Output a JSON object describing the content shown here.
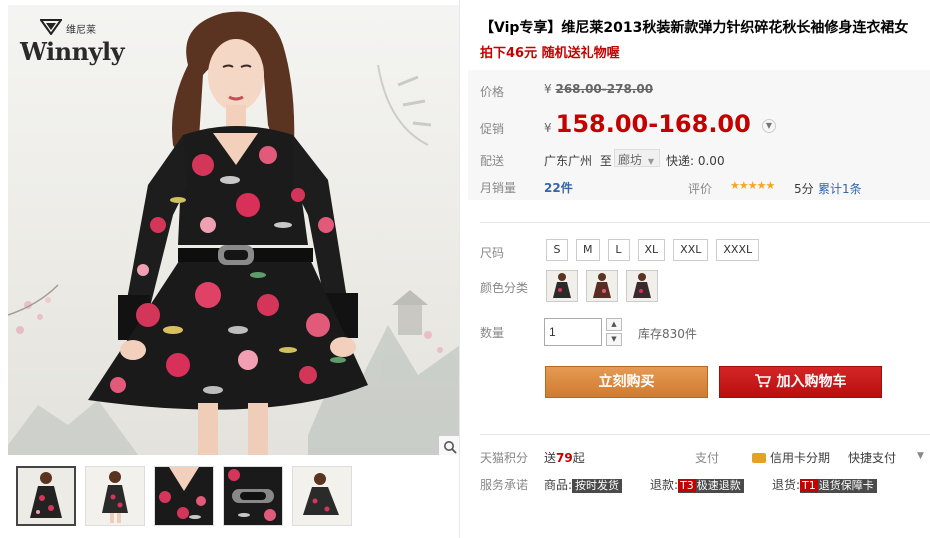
{
  "gallery": {
    "logo_cn": "维尼莱",
    "logo_en": "Winnyly",
    "thumbnails": [
      "thumb-1",
      "thumb-2",
      "thumb-3",
      "thumb-4",
      "thumb-5"
    ]
  },
  "product": {
    "title": "【Vip专享】维尼莱2013秋装新款弹力针织碎花秋长袖修身连衣裙女",
    "subtitle": "拍下46元 随机送礼物喔"
  },
  "price": {
    "label": "价格",
    "currency": "¥",
    "original": "268.00-278.00",
    "promo_label": "促销",
    "promo": "158.00-168.00"
  },
  "shipping": {
    "label": "配送",
    "from": "广东广州",
    "to_word": "至",
    "dest": "廊坊",
    "fee": "快递: 0.00"
  },
  "sales": {
    "label": "月销量",
    "count": "22件",
    "rating_label": "评价",
    "stars": "★★★★★",
    "score": "5分",
    "reviews": "累计1条"
  },
  "size": {
    "label": "尺码",
    "options": [
      "S",
      "M",
      "L",
      "XL",
      "XXL",
      "XXXL"
    ]
  },
  "color": {
    "label": "颜色分类",
    "options": [
      "color-1",
      "color-2",
      "color-3"
    ]
  },
  "quantity": {
    "label": "数量",
    "value": "1",
    "up": "▲",
    "down": "▼",
    "stock": "库存830件"
  },
  "actions": {
    "buy": "立刻购买",
    "cart": "加入购物车"
  },
  "points": {
    "label": "天猫积分",
    "prefix": "送",
    "value": "79",
    "suffix": "起"
  },
  "payment": {
    "label": "支付",
    "credit": "信用卡分期",
    "quick": "快捷支付"
  },
  "service": {
    "label": "服务承诺",
    "goods_label": "商品:",
    "goods_tag": "按时发货",
    "refund_label": "退款:",
    "refund_t": "T3",
    "refund_tag": "极速退款",
    "return_label": "退货:",
    "return_t": "T1",
    "return_tag": "退货保障卡"
  },
  "colors": {
    "accent_red": "#c40000",
    "buy_orange": "#d9853b",
    "link_blue": "#3366aa"
  }
}
